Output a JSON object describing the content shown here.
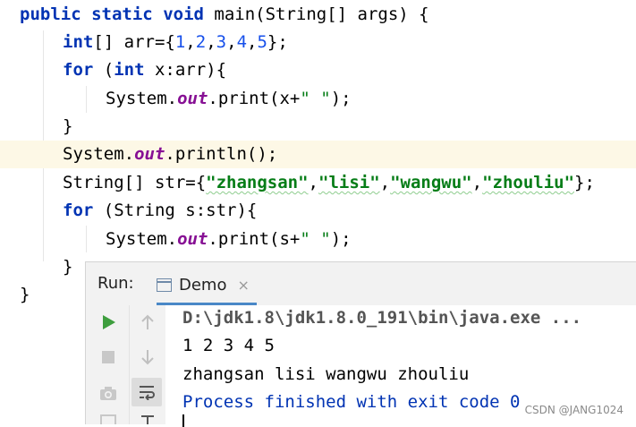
{
  "code": {
    "line1": {
      "kw1": "public",
      "kw2": "static",
      "kw3": "void",
      "rest": " main(String[] args) {"
    },
    "line2": {
      "kw": "int",
      "a": "[] arr={",
      "n1": "1",
      "c1": ",",
      "n2": "2",
      "c2": ",",
      "n3": "3",
      "c3": ",",
      "n4": "4",
      "c4": ",",
      "n5": "5",
      "b": "};"
    },
    "line3": {
      "kw1": "for",
      "a": " (",
      "kw2": "int",
      "b": " x:arr){"
    },
    "line4": {
      "a": "System.",
      "fld": "out",
      "b": ".print(x+",
      "s": "\" \"",
      "c": ");"
    },
    "line5": {
      "a": "}"
    },
    "line6": {
      "a": "System.",
      "fld": "out",
      "b": ".println();"
    },
    "line7": {
      "a": "String[] str={",
      "s1": "\"zhangsan\"",
      "c1": ",",
      "s2": "\"lisi\"",
      "c2": ",",
      "s3": "\"wangwu\"",
      "c3": ",",
      "s4": "\"zhouliu\"",
      "b": "};"
    },
    "line8": {
      "kw": "for",
      "a": " (String s:str){"
    },
    "line9": {
      "a": "System.",
      "fld": "out",
      "b": ".print(s+",
      "s": "\" \"",
      "c": ");"
    },
    "line10": {
      "a": "}"
    },
    "line11": {
      "a": "}"
    }
  },
  "run_panel": {
    "label": "Run:",
    "tab_label": "Demo",
    "tab_close": "×",
    "console": {
      "command": "D:\\jdk1.8\\jdk1.8.0_191\\bin\\java.exe ...",
      "output1": "1 2 3 4 5 ",
      "output2": "zhangsan lisi wangwu zhouliu ",
      "finished": "Process finished with exit code 0"
    }
  },
  "watermark": "CSDN @JANG1024",
  "colors": {
    "keyword": "#0033b3",
    "number": "#1750eb",
    "string": "#067d17",
    "field": "#871094",
    "run_green": "#3e9e3e"
  }
}
